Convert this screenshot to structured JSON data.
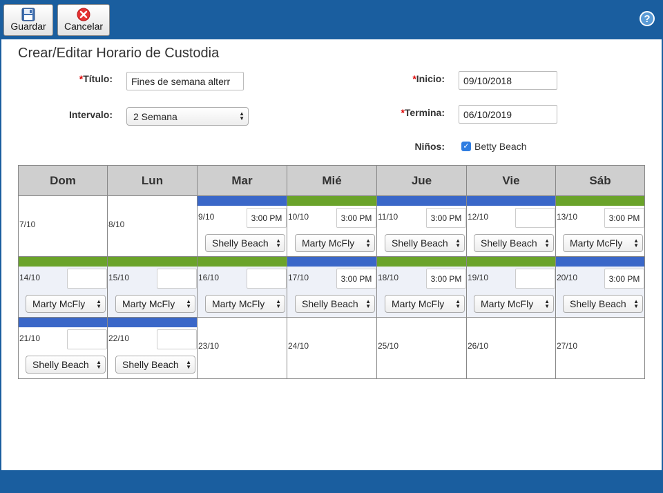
{
  "toolbar": {
    "save_label": "Guardar",
    "cancel_label": "Cancelar",
    "help_label": "?"
  },
  "page": {
    "title": "Crear/Editar Horario de Custodia"
  },
  "form": {
    "required_mark": "*",
    "titulo_label": "Título:",
    "titulo_value": "Fines de semana alterr",
    "intervalo_label": "Intervalo:",
    "intervalo_value": "2 Semana",
    "inicio_label": "Inicio:",
    "inicio_value": "09/10/2018",
    "termina_label": "Termina:",
    "termina_value": "06/10/2019",
    "ninos_label": "Niños:",
    "child_name": "Betty Beach",
    "child_checked": true
  },
  "calendar": {
    "days": [
      "Dom",
      "Lun",
      "Mar",
      "Mié",
      "Jue",
      "Vie",
      "Sáb"
    ],
    "colors": {
      "blue": "#3a67c8",
      "green": "#6aa32a"
    },
    "weeks": [
      [
        {
          "date": "7/10"
        },
        {
          "date": "8/10"
        },
        {
          "date": "9/10",
          "band": "blue",
          "time": "3:00 PM",
          "parent": "Shelly Beach"
        },
        {
          "date": "10/10",
          "band": "green",
          "time": "3:00 PM",
          "parent": "Marty McFly"
        },
        {
          "date": "11/10",
          "band": "blue",
          "time": "3:00 PM",
          "parent": "Shelly Beach"
        },
        {
          "date": "12/10",
          "band": "blue",
          "time": "",
          "parent": "Shelly Beach"
        },
        {
          "date": "13/10",
          "band": "green",
          "time": "3:00 PM",
          "parent": "Marty McFly"
        }
      ],
      [
        {
          "date": "14/10",
          "band": "green",
          "time": "",
          "parent": "Marty McFly",
          "shade": true
        },
        {
          "date": "15/10",
          "band": "green",
          "time": "",
          "parent": "Marty McFly",
          "shade": true
        },
        {
          "date": "16/10",
          "band": "green",
          "time": "",
          "parent": "Marty McFly",
          "shade": true
        },
        {
          "date": "17/10",
          "band": "blue",
          "time": "3:00 PM",
          "parent": "Shelly Beach",
          "shade": true
        },
        {
          "date": "18/10",
          "band": "green",
          "time": "3:00 PM",
          "parent": "Marty McFly",
          "shade": true
        },
        {
          "date": "19/10",
          "band": "green",
          "time": "",
          "parent": "Marty McFly",
          "shade": true
        },
        {
          "date": "20/10",
          "band": "blue",
          "time": "3:00 PM",
          "parent": "Shelly Beach",
          "shade": true
        }
      ],
      [
        {
          "date": "21/10",
          "band": "blue",
          "time": "",
          "parent": "Shelly Beach"
        },
        {
          "date": "22/10",
          "band": "blue",
          "time": "",
          "parent": "Shelly Beach"
        },
        {
          "date": "23/10"
        },
        {
          "date": "24/10"
        },
        {
          "date": "25/10"
        },
        {
          "date": "26/10"
        },
        {
          "date": "27/10"
        }
      ]
    ]
  }
}
